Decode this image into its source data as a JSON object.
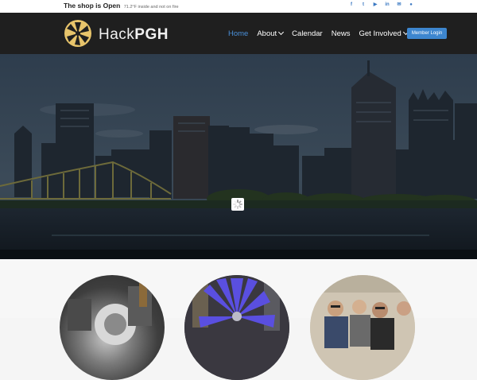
{
  "topbar": {
    "status_prefix": "The shop is",
    "status_word": "Open",
    "temperature": "71.2°F inside and not on fire",
    "social_icons": [
      "facebook-icon",
      "twitter-icon",
      "youtube-icon",
      "linkedin-icon",
      "email-icon",
      "flickr-icon"
    ]
  },
  "header": {
    "brand_light": "Hack",
    "brand_bold": "PGH",
    "nav": [
      {
        "label": "Home",
        "active": true
      },
      {
        "label": "About",
        "dropdown": true
      },
      {
        "label": "Calendar"
      },
      {
        "label": "News"
      },
      {
        "label": "Get Involved",
        "dropdown": true
      }
    ],
    "login_label": "Member Login"
  },
  "colors": {
    "accent": "#3d86cf",
    "nav_active": "#4a90d9",
    "header_bg": "#1f1f1f",
    "logo_gold": "#e7c46b"
  },
  "hero": {
    "image": "pittsburgh-skyline-photo",
    "loading": true
  },
  "features": [
    {
      "image": "lathe-machine-photo"
    },
    {
      "image": "blue-windmill-sculpture-photo"
    },
    {
      "image": "members-group-photo"
    }
  ]
}
